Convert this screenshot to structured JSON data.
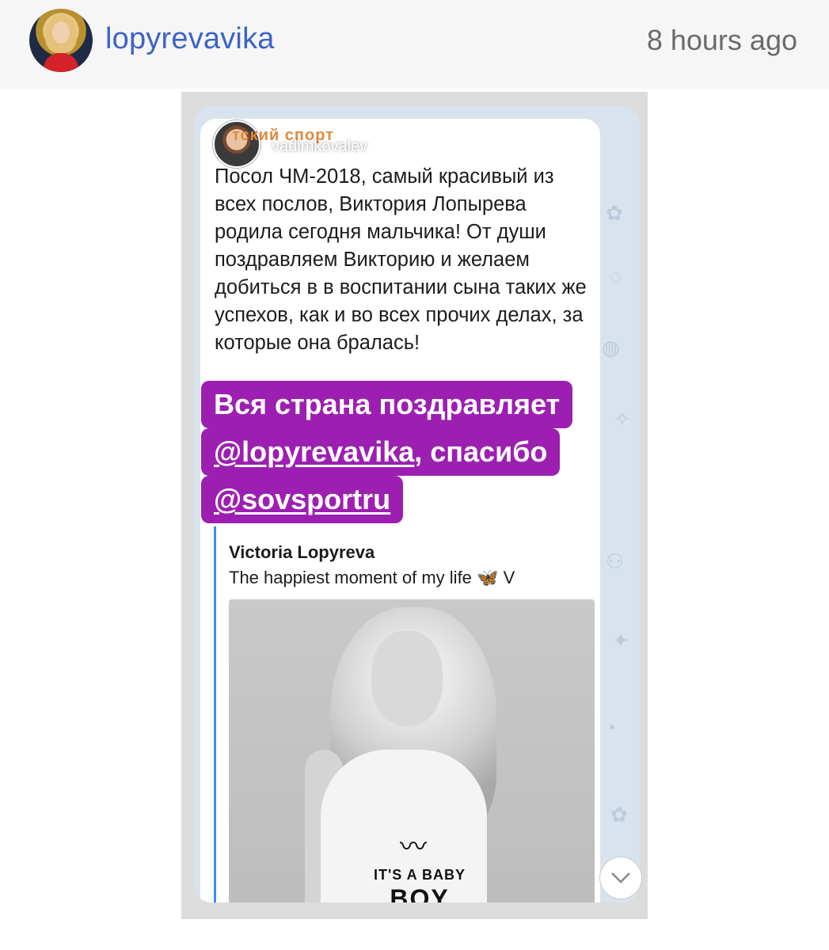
{
  "header": {
    "username": "lopyrevavika",
    "time_ago": "8 hours ago"
  },
  "post": {
    "channel_name": "тский спорт",
    "mention_username": "vadimkovalev",
    "text": "Посол ЧМ-2018, самый красивый из всех послов, Виктория Лопырева родила сегодня мальчика! От души поздравляем Викторию и желаем добиться в в воспитании сына таких же успехов, как и во всех прочих делах, за которые она бралась!"
  },
  "sticker": {
    "line1": "Вся страна поздравляет",
    "line2_mention": "@lopyrevavika",
    "line2_rest": ", спасибо",
    "line3_mention": "@sovsportru"
  },
  "reply": {
    "author": "Victoria Lopyreva",
    "caption": "The happiest moment of my life",
    "caption_suffix": "V",
    "shirt_line1": "IT'S A BABY",
    "shirt_line2": "BOY"
  },
  "icons": {
    "scroll_down": "chevron-down-icon",
    "butterfly": "butterfly-icon"
  },
  "colors": {
    "username": "#3d63c9",
    "sticker_bg": "#9d1fb2",
    "channel": "#e08a3c",
    "reply_border": "#3f8de0"
  }
}
